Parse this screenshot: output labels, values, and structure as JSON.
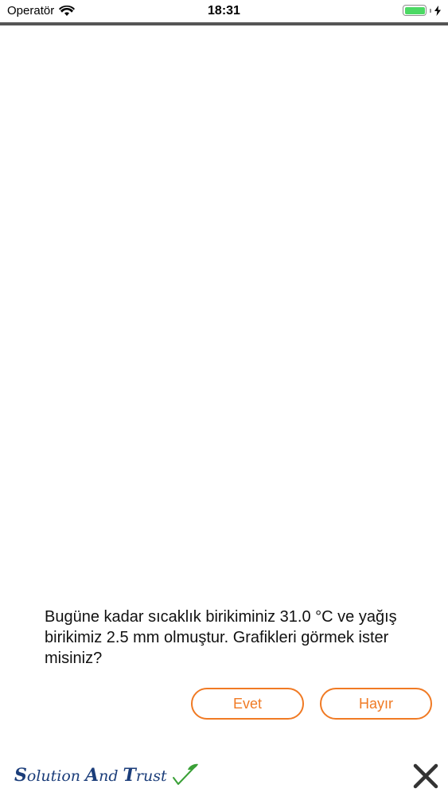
{
  "status_bar": {
    "carrier": "Operatör",
    "time": "18:31",
    "battery_color": "#4cd964"
  },
  "message": {
    "text": "Bugüne kadar sıcaklık birikiminiz 31.0 °C  ve yağış birikimiz 2.5 mm olmuştur. Grafikleri görmek ister misiniz?"
  },
  "buttons": {
    "yes_label": "Evet",
    "no_label": "Hayır",
    "accent_color": "#f07a24"
  },
  "footer": {
    "logo": {
      "word1_cap": "S",
      "word1_rest": "olution",
      "word2_cap": "A",
      "word2_rest": "nd",
      "word3_cap": "T",
      "word3_rest": "rust",
      "brand_color": "#1b3d7a",
      "check_color": "#3aa037"
    },
    "close_icon": "close-icon"
  }
}
